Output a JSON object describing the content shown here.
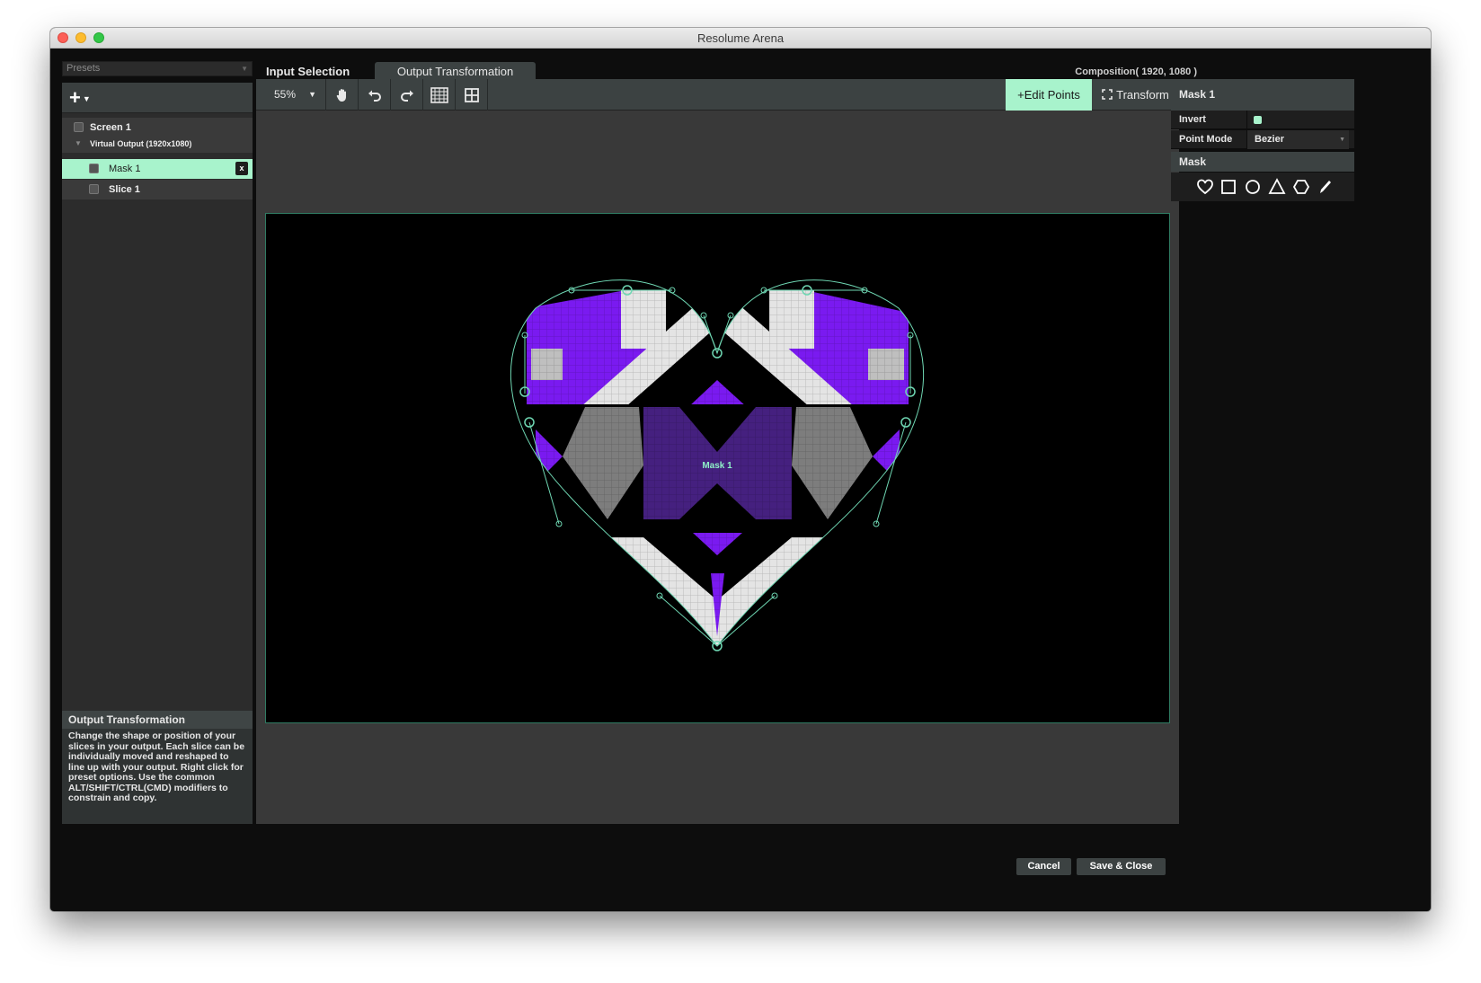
{
  "window": {
    "title": "Resolume Arena"
  },
  "presets": {
    "label": "Presets"
  },
  "tabs": [
    {
      "label": "Input Selection"
    },
    {
      "label": "Output Transformation"
    }
  ],
  "composition": {
    "label": "Composition( 1920, 1080 )"
  },
  "tree": {
    "screen": "Screen 1",
    "virtual_output": "Virtual Output (1920x1080)",
    "mask": "Mask 1",
    "mask_remove": "x",
    "slice": "Slice 1"
  },
  "info": {
    "title": "Output Transformation",
    "body": "Change the shape or position of your slices in your output. Each slice can be individually moved and reshaped to line up with your output. Right click for preset options. Use the common ALT/SHIFT/CTRL(CMD) modifiers to constrain and copy."
  },
  "toolbar": {
    "zoom": "55%",
    "edit_points": "Edit Points",
    "transform": "Transform",
    "icons": [
      "hand-icon",
      "undo-icon",
      "redo-icon",
      "grid-icon",
      "snap-grid-icon"
    ]
  },
  "stage": {
    "mask_label": "Mask 1"
  },
  "properties": {
    "title": "Mask 1",
    "invert_label": "Invert",
    "invert_checked": true,
    "point_mode_label": "Point Mode",
    "point_mode_value": "Bezier",
    "mask_header": "Mask",
    "shape_icons": [
      "heart-icon",
      "square-icon",
      "circle-icon",
      "triangle-icon",
      "hexagon-icon",
      "pen-icon"
    ]
  },
  "footer": {
    "cancel": "Cancel",
    "save": "Save & Close"
  },
  "colors": {
    "accent": "#a8f3cc",
    "purple": "#7a1af0",
    "panel": "#3c4242"
  }
}
